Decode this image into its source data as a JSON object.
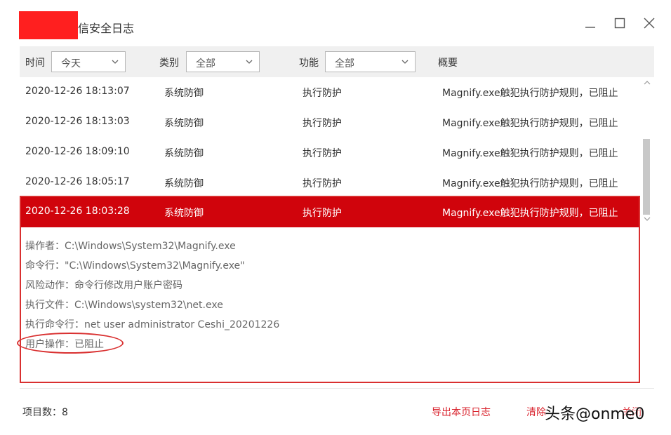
{
  "window": {
    "title": "信安全日志",
    "controls": {
      "minimize": "minimize-icon",
      "maximize": "maximize-icon",
      "close": "close-icon"
    }
  },
  "filters": {
    "time": {
      "label": "时间",
      "value": "今天"
    },
    "category": {
      "label": "类别",
      "value": "全部"
    },
    "function": {
      "label": "功能",
      "value": "全部"
    },
    "summary_header": "概要"
  },
  "rows": [
    {
      "time": "2020-12-26 18:13:07",
      "category": "系统防御",
      "function": "执行防护",
      "summary": "Magnify.exe触犯执行防护规则，已阻止"
    },
    {
      "time": "2020-12-26 18:13:03",
      "category": "系统防御",
      "function": "执行防护",
      "summary": "Magnify.exe触犯执行防护规则，已阻止"
    },
    {
      "time": "2020-12-26 18:09:10",
      "category": "系统防御",
      "function": "执行防护",
      "summary": "Magnify.exe触犯执行防护规则，已阻止"
    },
    {
      "time": "2020-12-26 18:05:17",
      "category": "系统防御",
      "function": "执行防护",
      "summary": "Magnify.exe触犯执行防护规则，已阻止"
    },
    {
      "time": "2020-12-26 18:03:28",
      "category": "系统防御",
      "function": "执行防护",
      "summary": "Magnify.exe触犯执行防护规则，已阻止"
    }
  ],
  "detail": {
    "operator": "操作者：C:\\Windows\\System32\\Magnify.exe",
    "command_line": "命令行：\"C:\\Windows\\System32\\Magnify.exe\"",
    "risk_action": "风险动作：命令行修改用户账户密码",
    "exec_file": "执行文件：C:\\Windows\\system32\\net.exe",
    "exec_command": "执行命令行：net  user administrator Ceshi_20201226",
    "user_action": "用户操作：已阻止"
  },
  "footer": {
    "item_count": "项目数：8",
    "export_label": "导出本页日志",
    "clear_label": "清除",
    "close_label": "关闭"
  },
  "watermark": "头条@onme0",
  "colors": {
    "selected_row": "#d0040c",
    "accent_link": "#d9232d",
    "highlight_border": "#d93030"
  }
}
